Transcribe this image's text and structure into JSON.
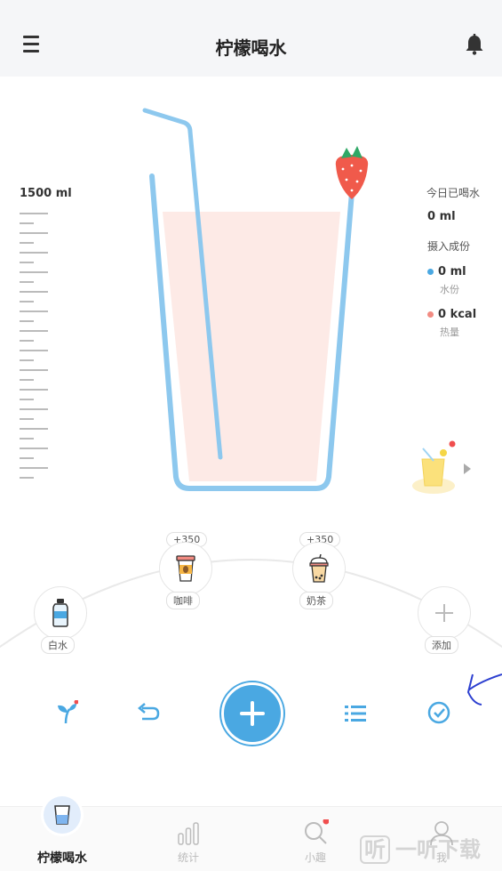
{
  "header": {
    "title": "柠檬喝水",
    "menu_icon": "menu-icon",
    "bell_icon": "bell-icon"
  },
  "scale": {
    "max_label": "1500 ml"
  },
  "stats": {
    "today_label": "今日已喝水",
    "today_value": "0 ml",
    "intake_label": "摄入成份",
    "water_value": "0 ml",
    "water_label": "水份",
    "calorie_value": "0 kcal",
    "calorie_label": "热量",
    "water_color": "#4aa8e2",
    "calorie_color": "#f28b82"
  },
  "drinks": [
    {
      "label": "白水",
      "badge": ""
    },
    {
      "label": "咖啡",
      "badge": "+350"
    },
    {
      "label": "奶茶",
      "badge": "+350"
    },
    {
      "label": "添加",
      "badge": ""
    }
  ],
  "actions": [
    "sprout-icon",
    "undo-icon",
    "add-icon",
    "list-icon",
    "check-icon"
  ],
  "tabs": [
    {
      "label": "柠檬喝水",
      "active": true
    },
    {
      "label": "统计",
      "active": false
    },
    {
      "label": "小趣",
      "active": false
    },
    {
      "label": "我",
      "active": false
    }
  ],
  "watermark": "一听下载",
  "colors": {
    "accent": "#4aa8e2",
    "glass_fill": "#fdeae6",
    "glass_stroke": "#8dc8ee",
    "badge_red": "#f04e4e"
  }
}
